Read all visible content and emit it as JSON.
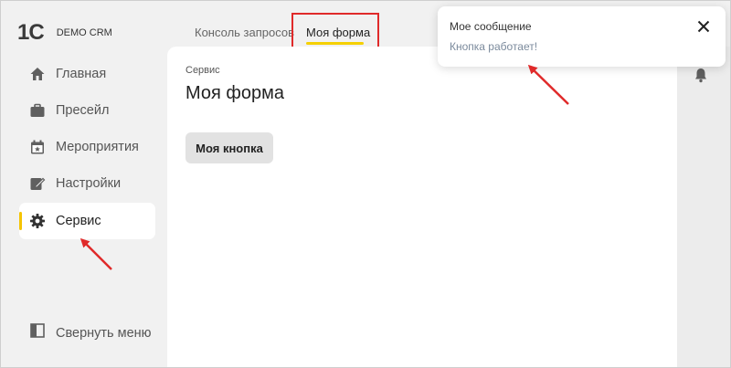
{
  "app": {
    "logo_text": "1С",
    "name": "DEMO CRM"
  },
  "sidebar": {
    "items": [
      {
        "label": "Главная",
        "icon": "home-icon"
      },
      {
        "label": "Пресейл",
        "icon": "briefcase-icon"
      },
      {
        "label": "Мероприятия",
        "icon": "calendar-icon"
      },
      {
        "label": "Настройки",
        "icon": "edit-icon"
      },
      {
        "label": "Сервис",
        "icon": "gear-icon",
        "active": true
      }
    ],
    "collapse_label": "Свернуть меню"
  },
  "tabs": [
    {
      "label": "Консоль запросов"
    },
    {
      "label": "Моя форма",
      "active": true
    }
  ],
  "main": {
    "breadcrumb": "Сервис",
    "title": "Моя форма",
    "button_label": "Моя кнопка"
  },
  "toast": {
    "title": "Мое сообщение",
    "message": "Кнопка работает!"
  },
  "colors": {
    "accent": "#f5c400",
    "annotation": "#e02a2a",
    "background": "#f1f1f1"
  }
}
